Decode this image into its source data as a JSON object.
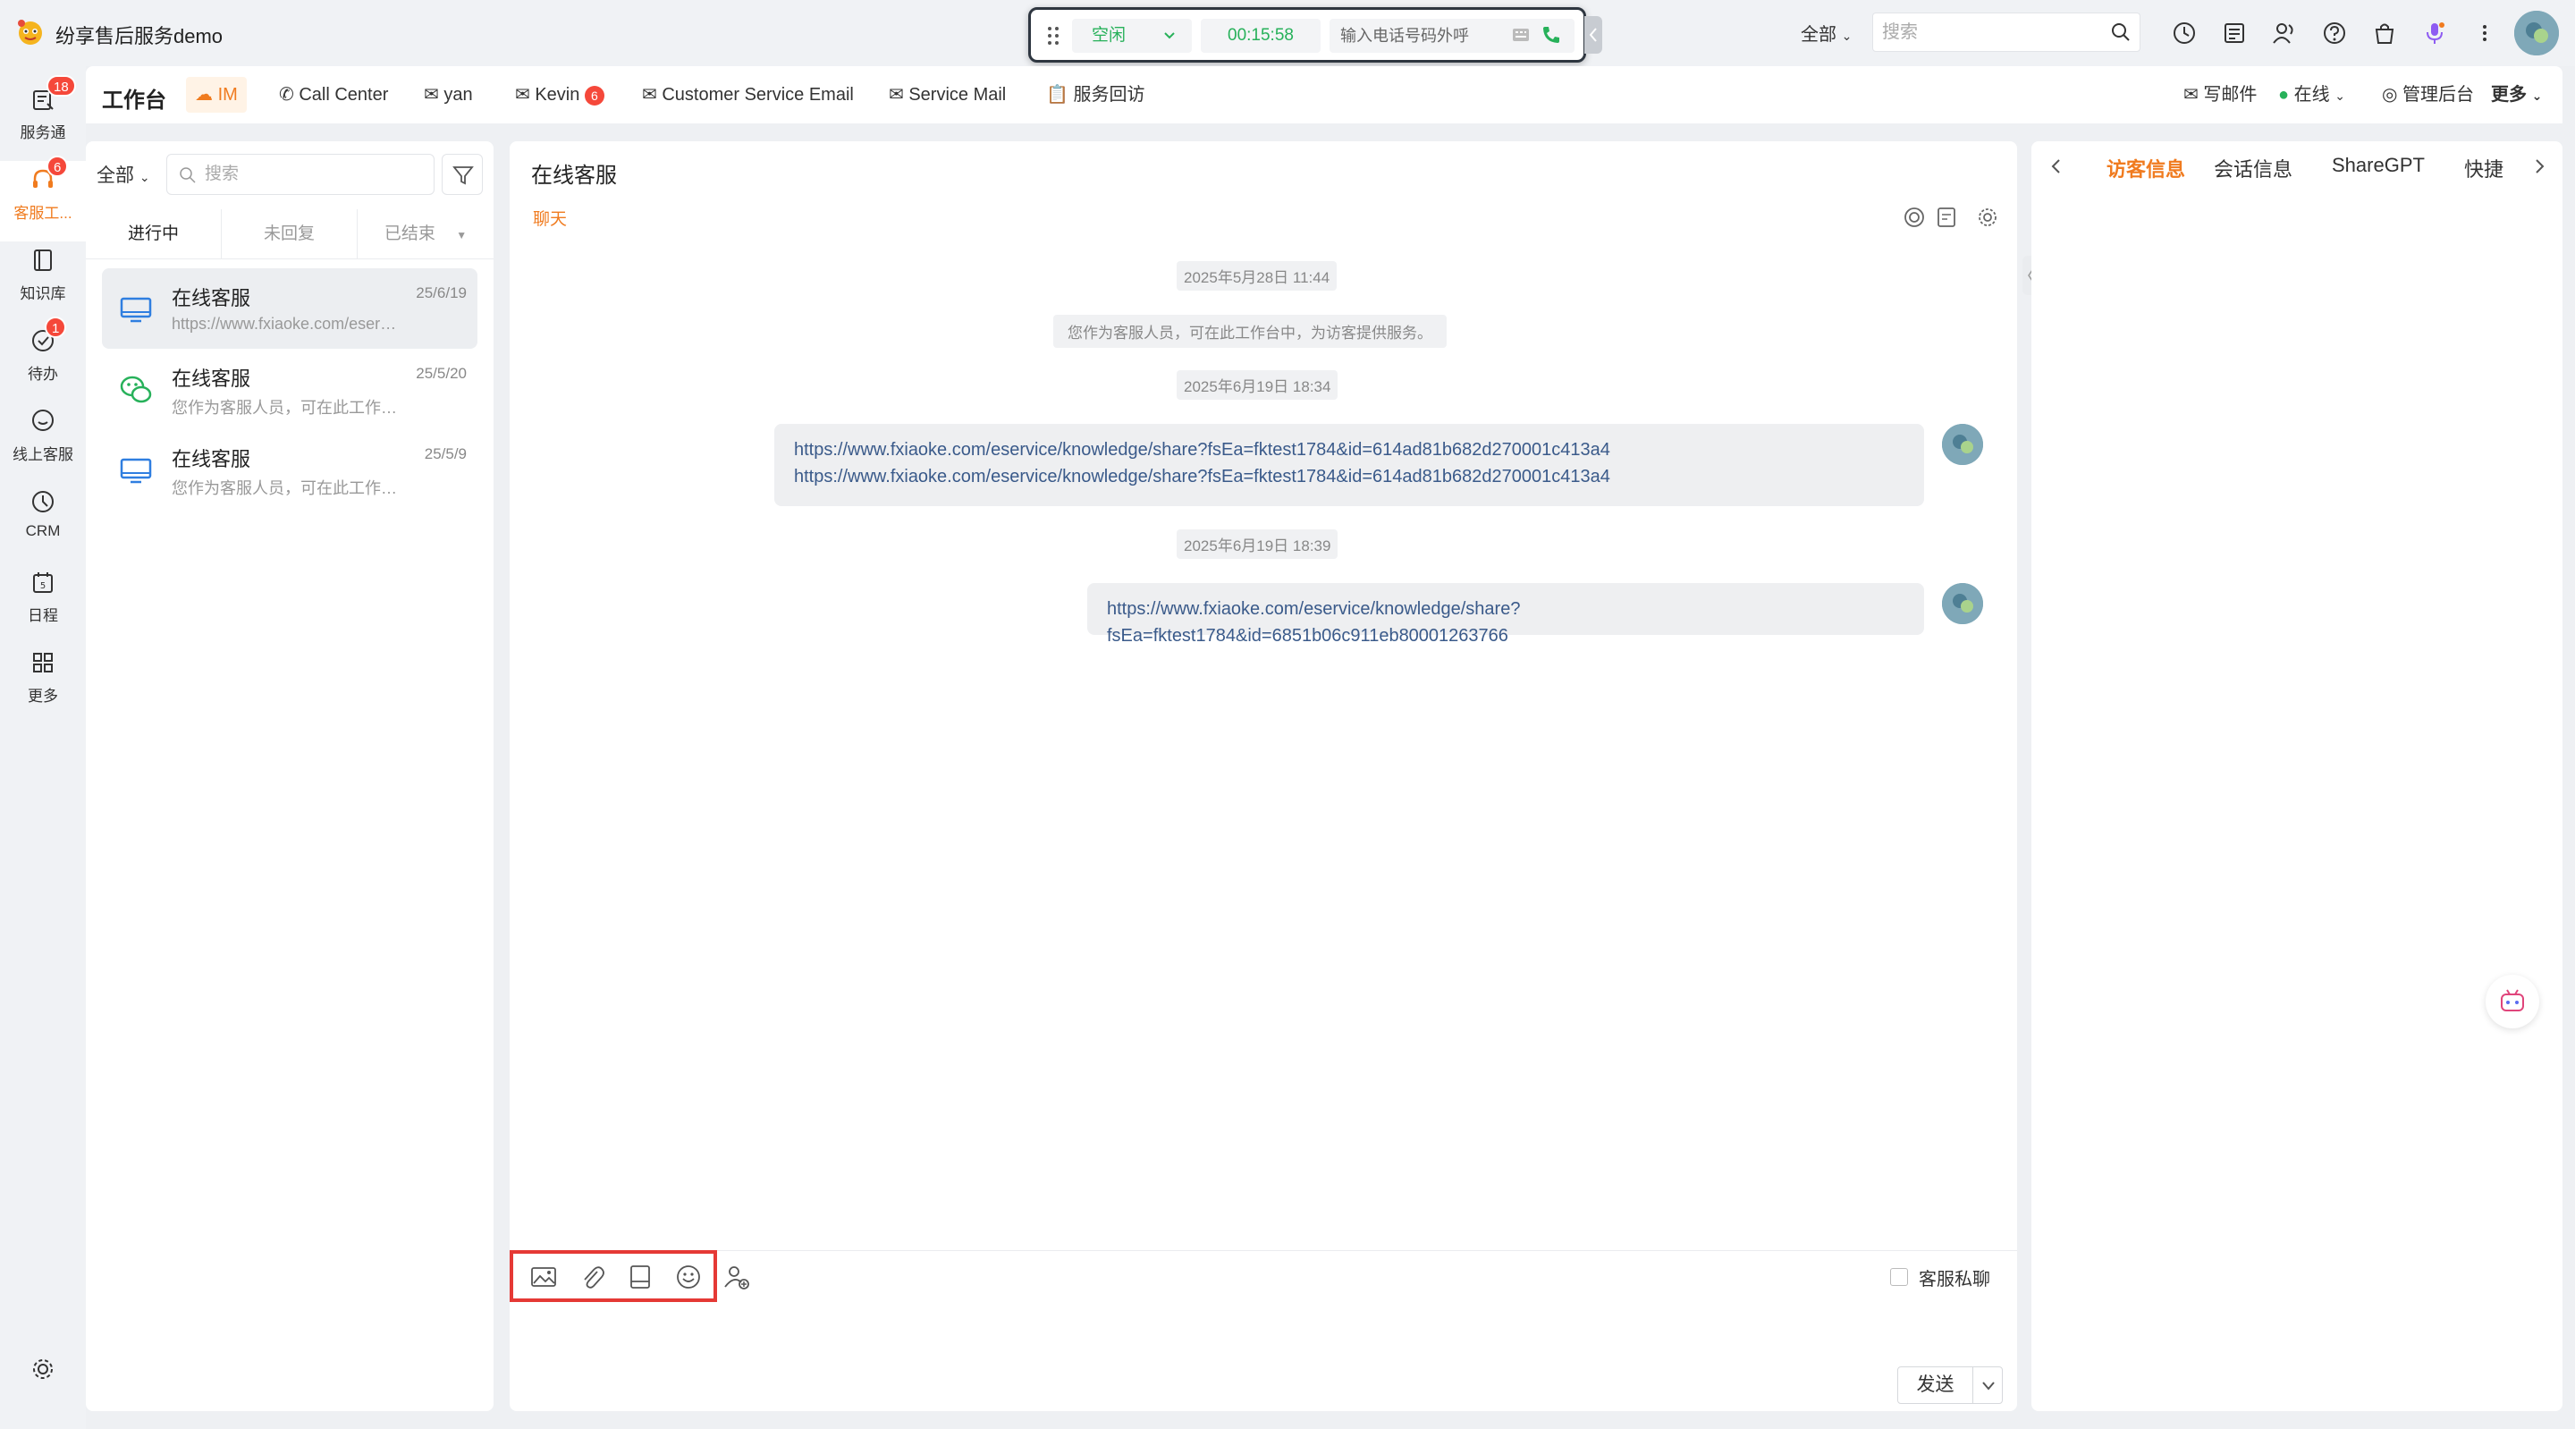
{
  "app": {
    "title": "纷享售后服务demo"
  },
  "call_widget": {
    "status": "空闲",
    "timer": "00:15:58",
    "phone_placeholder": "输入电话号码外呼"
  },
  "top_search": {
    "scope": "全部",
    "placeholder": "搜索"
  },
  "left_rail": {
    "items": [
      {
        "label": "服务通",
        "badge": "18"
      },
      {
        "label": "客服工...",
        "badge": "6"
      },
      {
        "label": "知识库",
        "badge": ""
      },
      {
        "label": "待办",
        "badge": "1"
      },
      {
        "label": "线上客服",
        "badge": ""
      },
      {
        "label": "CRM",
        "badge": ""
      },
      {
        "label": "日程",
        "badge": ""
      },
      {
        "label": "更多",
        "badge": ""
      }
    ]
  },
  "tabbar": {
    "workbench": "工作台",
    "tabs": [
      {
        "label": "IM"
      },
      {
        "label": "Call Center"
      },
      {
        "label": "yan"
      },
      {
        "label": "Kevin",
        "badge": "6"
      },
      {
        "label": "Customer Service Email"
      },
      {
        "label": "Service Mail"
      },
      {
        "label": "服务回访"
      }
    ],
    "right": {
      "write_mail": "写邮件",
      "status": "在线",
      "admin": "管理后台",
      "more": "更多"
    }
  },
  "conv_list": {
    "scope": "全部",
    "search_placeholder": "搜索",
    "tabs": [
      "进行中",
      "未回复",
      "已结束"
    ],
    "items": [
      {
        "name": "在线客服",
        "date": "25/6/19",
        "preview": "https://www.fxiaoke.com/eservice/knowledge/share"
      },
      {
        "name": "在线客服",
        "date": "25/5/20",
        "preview": "您作为客服人员，可在此工作台中"
      },
      {
        "name": "在线客服",
        "date": "25/5/9",
        "preview": "您作为客服人员，可在此工作台中"
      }
    ]
  },
  "chat": {
    "title": "在线客服",
    "subtab": "聊天",
    "messages": {
      "ts1": "2025年5月28日 11:44",
      "sys1": "您作为客服人员，可在此工作台中，为访客提供服务。",
      "ts2": "2025年6月19日 18:34",
      "bubble1_line1": "https://www.fxiaoke.com/eservice/knowledge/share?fsEa=fktest1784&id=614ad81b682d270001c413a4",
      "bubble1_line2": "https://www.fxiaoke.com/eservice/knowledge/share?fsEa=fktest1784&id=614ad81b682d270001c413a4",
      "ts3": "2025年6月19日 18:39",
      "bubble2": "https://www.fxiaoke.com/eservice/knowledge/share?fsEa=fktest1784&id=6851b06c911eb80001263766"
    },
    "composer": {
      "private_label": "客服私聊",
      "send_label": "发送"
    }
  },
  "right_panel": {
    "tabs": [
      "访客信息",
      "会话信息",
      "ShareGPT",
      "快捷"
    ]
  },
  "colors": {
    "accent": "#f07b1f",
    "green": "#27b15a",
    "badge": "#f5483a",
    "highlight": "#e53935"
  }
}
